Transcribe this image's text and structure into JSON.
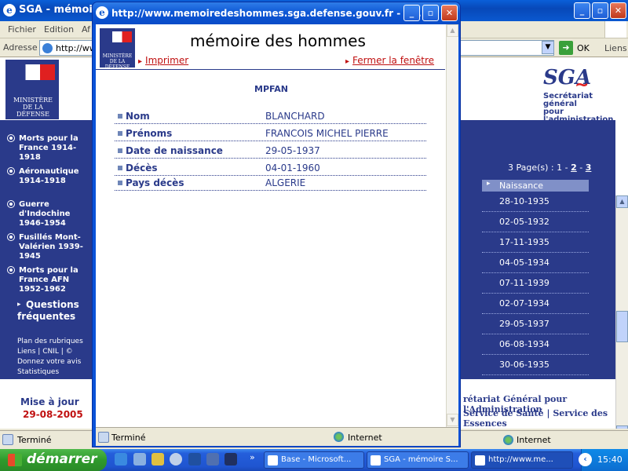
{
  "main_window": {
    "title": "SGA - mémoire",
    "menu": [
      "Fichier",
      "Edition",
      "Af"
    ],
    "address_label": "Adresse",
    "address_value": "http://ww",
    "go_label": "OK",
    "links_label": "Liens",
    "status_text": "Terminé",
    "zone_text": "Internet"
  },
  "left_nav": {
    "ministry": "MINISTÈRE DE LA DÉFENSE",
    "items": [
      "Morts pour la France 1914-1918",
      "Aéronautique 1914-1918",
      "Guerre d'Indochine 1946-1954",
      "Fusillés Mont-Valérien 1939-1945",
      "Morts pour la France AFN 1952-1962"
    ],
    "faq": "Questions fréquentes",
    "small_links": [
      "Plan des rubriques",
      "Liens | CNIL | ©",
      "Donnez votre avis",
      "Statistiques"
    ],
    "update_label": "Mise à jour",
    "update_date": "29-08-2005"
  },
  "right_panel": {
    "sga_logo": "SGA",
    "sga_sub1": "Secrétariat général",
    "sga_sub2": "pour l'administration",
    "pages_text": "3 Page(s) : 1 -",
    "page2": "2",
    "page_sep": " - ",
    "page3": "3",
    "column_header": "Naissance",
    "dates": [
      "28-10-1935",
      "02-05-1932",
      "17-11-1935",
      "04-05-1934",
      "07-11-1939",
      "02-07-1934",
      "29-05-1937",
      "06-08-1934",
      "30-06-1935"
    ],
    "footer1": "rétariat Général pour l'Administration",
    "footer2a": "Service de Santé",
    "footer2b": "| Service des Essences"
  },
  "popup": {
    "title": "http://www.memoiredeshommes.sga.defense.gouv.fr - S...",
    "logo_text": "MINISTÈRE DE LA DÉFENSE",
    "heading": "mémoire des hommes",
    "print_link": "Imprimer",
    "close_link": "Fermer la fenêtre",
    "subtitle": "MPFAN",
    "fields": [
      {
        "label": "Nom",
        "value": "BLANCHARD"
      },
      {
        "label": "Prénoms",
        "value": "FRANCOIS MICHEL PIERRE"
      },
      {
        "label": "Date de naissance",
        "value": "29-05-1937"
      },
      {
        "label": "Décès",
        "value": "04-01-1960"
      },
      {
        "label": "Pays décès",
        "value": "ALGERIE"
      }
    ],
    "status_text": "Terminé",
    "zone_text": "Internet"
  },
  "taskbar": {
    "start_label": "démarrer",
    "tasks": [
      "Base - Microsoft...",
      "SGA - mémoire S...",
      "http://www.me..."
    ],
    "clock": "15:40"
  },
  "colors": {
    "navy": "#2a3a8a",
    "link_red": "#c01010",
    "xp_blue": "#0a52d8"
  }
}
